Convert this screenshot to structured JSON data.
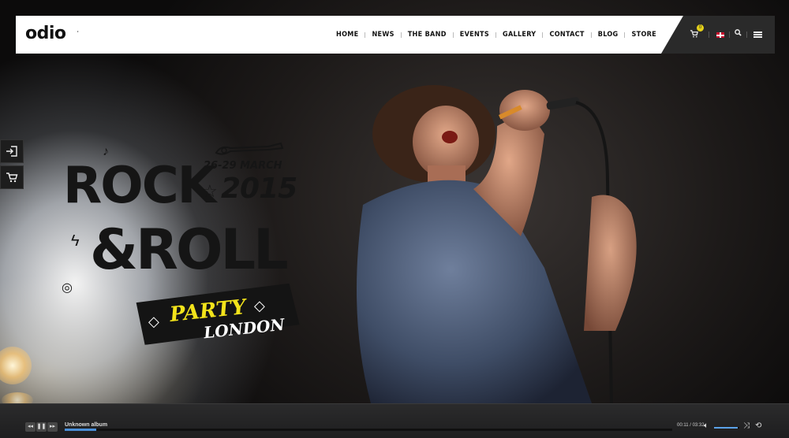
{
  "header": {
    "logo_text": "odio",
    "nav": [
      {
        "label": "HOME"
      },
      {
        "label": "NEWS"
      },
      {
        "label": "THE BAND"
      },
      {
        "label": "EVENTS"
      },
      {
        "label": "GALLERY"
      },
      {
        "label": "CONTACT"
      },
      {
        "label": "BLOG"
      },
      {
        "label": "STORE"
      }
    ],
    "cart_count": "0",
    "icons": [
      "cart-icon",
      "uk-flag-icon",
      "search-icon",
      "menu-icon"
    ]
  },
  "side_widgets": [
    "login-icon",
    "cart-icon"
  ],
  "hero": {
    "line1": "ROCK",
    "line2": "&ROLL",
    "dates": "26-29 MARCH",
    "year": "2015",
    "banner_line1": "PARTY",
    "banner_line2": "LONDON"
  },
  "player": {
    "track_title": "Unknown album",
    "time": "00:11 / 03:32",
    "progress_fraction": 0.052,
    "volume_fraction": 0.95,
    "controls": [
      "previous-icon",
      "pause-icon",
      "next-icon",
      "volume-icon",
      "shuffle-icon",
      "repeat-icon"
    ]
  },
  "colors": {
    "accent_yellow": "#f2e31b",
    "progress_blue": "#4a8fd8",
    "header_dark": "#2a2a2a"
  }
}
